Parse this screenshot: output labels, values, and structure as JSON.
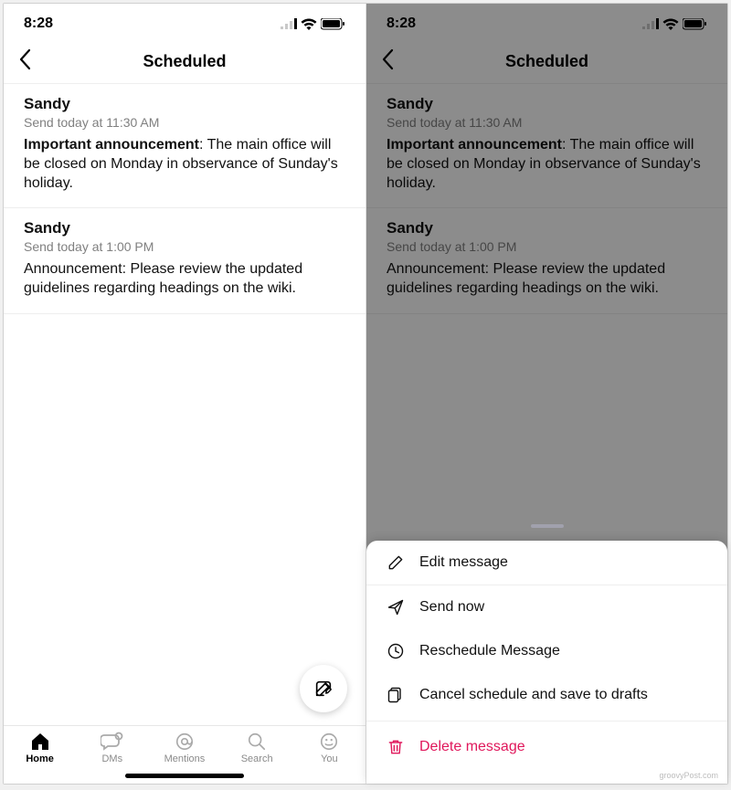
{
  "status": {
    "time": "8:28"
  },
  "header": {
    "title": "Scheduled"
  },
  "messages": [
    {
      "sender": "Sandy",
      "when": "Send today at 11:30 AM",
      "lead": "Important announcement",
      "rest": ": The main office will be closed on Monday in observance of Sunday's holiday."
    },
    {
      "sender": "Sandy",
      "when": "Send today at 1:00 PM",
      "lead": "",
      "rest": "Announcement: Please review the updated guidelines regarding headings on the wiki."
    }
  ],
  "nav": {
    "home": "Home",
    "dms": "DMs",
    "mentions": "Mentions",
    "search": "Search",
    "you": "You"
  },
  "sheet": {
    "edit": "Edit message",
    "send": "Send now",
    "reschedule": "Reschedule Message",
    "cancel": "Cancel schedule and save to drafts",
    "delete": "Delete message"
  },
  "watermark": "groovyPost.com"
}
